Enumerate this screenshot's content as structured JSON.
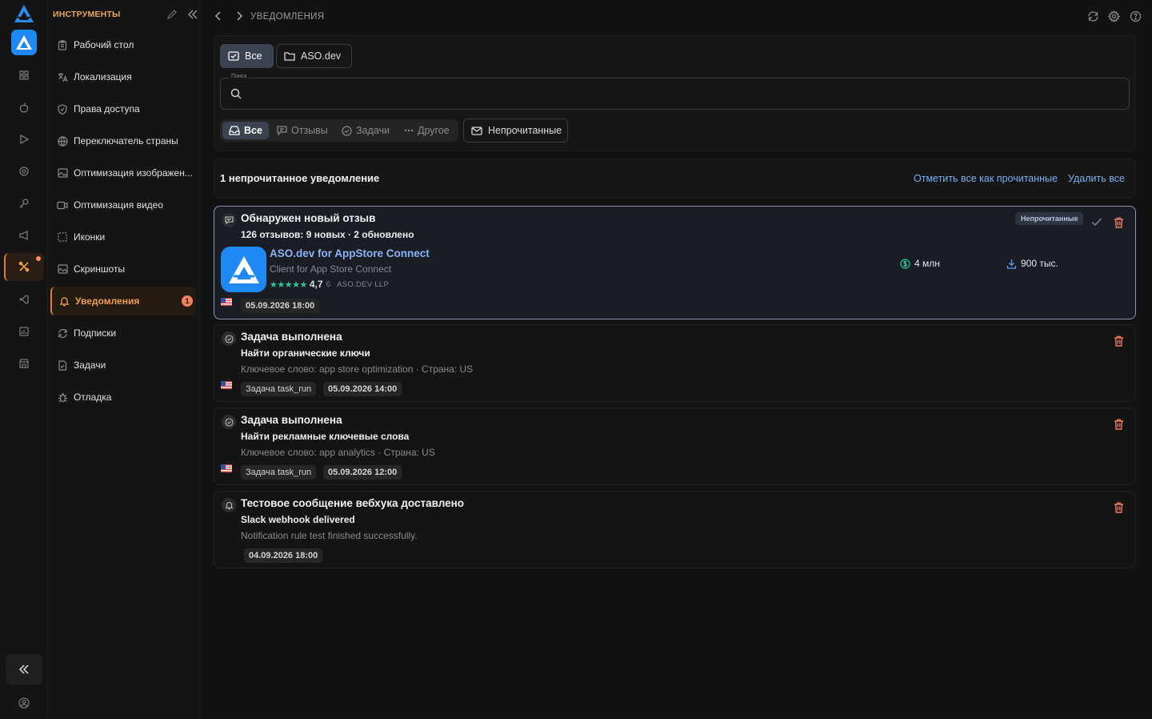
{
  "sidebar": {
    "title": "ИНСТРУМЕНТЫ",
    "items": [
      {
        "label": "Рабочий стол",
        "icon": "clipboard-icon"
      },
      {
        "label": "Локализация",
        "icon": "translate-icon"
      },
      {
        "label": "Права доступа",
        "icon": "shield-icon"
      },
      {
        "label": "Переключатель страны",
        "icon": "globe-icon"
      },
      {
        "label": "Оптимизация изображен...",
        "icon": "image-icon"
      },
      {
        "label": "Оптимизация видео",
        "icon": "video-icon"
      },
      {
        "label": "Иконки",
        "icon": "icons-icon"
      },
      {
        "label": "Скриншоты",
        "icon": "screenshot-icon"
      },
      {
        "label": "Уведомления",
        "icon": "bell-icon",
        "badge": "1"
      },
      {
        "label": "Подписки",
        "icon": "refresh-icon"
      },
      {
        "label": "Задачи",
        "icon": "task-icon"
      },
      {
        "label": "Отладка",
        "icon": "bug-icon"
      }
    ]
  },
  "topbar": {
    "title": "УВЕДОМЛЕНИЯ"
  },
  "filters": {
    "scope_all": "Все",
    "scope_app": "ASO.dev",
    "search_label": "Поиск",
    "search_value": "",
    "types": {
      "all": "Все",
      "reviews": "Отзывы",
      "tasks": "Задачи",
      "other": "Другое"
    },
    "unread_toggle": "Непрочитанные"
  },
  "list_header": {
    "count": "1 непрочитанное уведомление",
    "mark_all": "Отметить все как прочитанные",
    "delete_all": "Удалить все"
  },
  "notifications": [
    {
      "title": "Обнаружен новый отзыв",
      "subtitle": "126 отзывов: 9 новых · 2 обновлено",
      "badge": "Непрочитанные",
      "app": {
        "name": "ASO.dev for AppStore Connect",
        "subtitle": "Client for App Store Connect",
        "stars": "★★★★★",
        "rating": "4,7",
        "rating_count": "6",
        "publisher": "ASO.DEV LLP",
        "revenue": "4 млн",
        "downloads": "900 тыс."
      },
      "timestamp": "05.09.2026 18:00"
    },
    {
      "title": "Задача выполнена",
      "subtitle": "Найти органические ключи",
      "description": "Ключевое слово: app store optimization · Страна: US",
      "tag": "Задача task_run",
      "timestamp": "05.09.2026 14:00"
    },
    {
      "title": "Задача выполнена",
      "subtitle": "Найти рекламные ключевые слова",
      "description": "Ключевое слово: app analytics · Страна: US",
      "tag": "Задача task_run",
      "timestamp": "05.09.2026 12:00"
    },
    {
      "title": "Тестовое сообщение вебхука доставлено",
      "subtitle": "Slack webhook delivered",
      "description": "Notification rule test finished successfully.",
      "timestamp": "04.09.2026 18:00"
    }
  ],
  "colors": {
    "accent": "#f0a050",
    "link": "#7ab0f0",
    "delete": "#f07860",
    "app_blue": "#1e88f5",
    "rating_green": "#2ec4a0"
  }
}
